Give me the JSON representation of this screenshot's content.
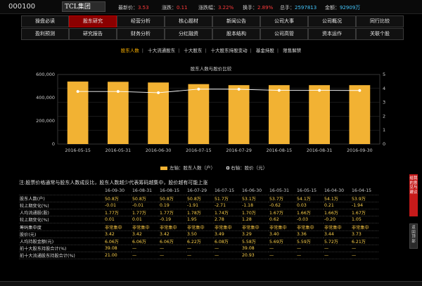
{
  "header": {
    "code": "000100",
    "name": "TCL集团",
    "latest_label": "最新价：",
    "latest_value": "3.53",
    "change_label": "涨跌：",
    "change_value": "0.11",
    "change_pct_label": "涨跌幅：",
    "change_pct_value": "3.22%",
    "turnover_label": "换手：",
    "turnover_value": "2.89%",
    "volume_label": "总手：",
    "volume_value": "2597813",
    "amount_label": "金额：",
    "amount_value": "92909万"
  },
  "nav": {
    "row1": [
      "操盘必读",
      "股东研究",
      "经营分析",
      "核心题材",
      "新闻公告",
      "公司大事",
      "公司概况",
      "同行比较"
    ],
    "row2": [
      "盈利预测",
      "研究报告",
      "财务分析",
      "分红融资",
      "股本结构",
      "公司高管",
      "资本运作",
      "关联个股"
    ]
  },
  "subtabs": [
    "股东人数",
    "十大流通股东",
    "十大股东",
    "十大股东持股变动",
    "基金持股",
    "限售解禁"
  ],
  "chart_title": "股东人数与股价比较",
  "legend": {
    "left": "左轴：股东人数（户）",
    "right": "右轴：股价（元）"
  },
  "chart_data": {
    "type": "bar",
    "categories": [
      "2016-05-15",
      "2016-05-31",
      "2016-06-30",
      "2016-07-15",
      "2016-07-29",
      "2016-08-15",
      "2016-08-31",
      "2016-09-30"
    ],
    "series": [
      {
        "name": "左轴：股东人数（户）",
        "type": "bar",
        "axis": "left",
        "values": [
          539000,
          537000,
          531000,
          517000,
          508000,
          508000,
          508000,
          508000
        ]
      },
      {
        "name": "右轴：股价（元）",
        "type": "line",
        "axis": "right",
        "values": [
          3.78,
          3.78,
          3.69,
          3.95,
          3.94,
          3.86,
          3.86,
          3.85
        ]
      }
    ],
    "left_ticks": [
      "0",
      "200,000",
      "400,000",
      "600,000"
    ],
    "right_ticks": [
      "0",
      "1",
      "2",
      "3",
      "4",
      "5"
    ],
    "ylim_left": [
      0,
      600000
    ],
    "ylim_right": [
      0,
      5
    ],
    "colors": {
      "bar": "#f2b233",
      "line": "#ffffff",
      "grid": "#555555"
    }
  },
  "note": "注:股票价格通常与股东人数成反比，股东人数越少代表筹码越集中，股价越有可能上涨",
  "table": {
    "dates": [
      "16-09-30",
      "16-08-31",
      "16-08-15",
      "16-07-29",
      "16-07-15",
      "16-06-30",
      "16-05-31",
      "16-05-15",
      "16-04-30",
      "16-04-15"
    ],
    "rows": [
      {
        "label": "股东人数(户)",
        "values": [
          "50.8万",
          "50.8万",
          "50.8万",
          "50.8万",
          "51.7万",
          "53.1万",
          "53.7万",
          "54.1万",
          "54.1万",
          "53.9万"
        ]
      },
      {
        "label": "较上期变化(%)",
        "values": [
          "-0.01",
          "-0.01",
          "0.19",
          "-1.91",
          "-2.71",
          "-1.18",
          "-0.62",
          "0.03",
          "0.21",
          "-1.94"
        ]
      },
      {
        "label": "人均流通股(股)",
        "values": [
          "1.77万",
          "1.77万",
          "1.77万",
          "1.78万",
          "1.74万",
          "1.70万",
          "1.67万",
          "1.66万",
          "1.66万",
          "1.67万"
        ]
      },
      {
        "label": "较上期变化(%)",
        "values": [
          "0.01",
          "0.01",
          "-0.19",
          "1.95",
          "2.78",
          "1.28",
          "0.62",
          "-0.03",
          "-0.20",
          "1.05"
        ]
      },
      {
        "label": "筹码集中度",
        "values": [
          "非常集中",
          "非常集中",
          "非常集中",
          "非常集中",
          "非常集中",
          "非常集中",
          "非常集中",
          "非常集中",
          "非常集中",
          "非常集中"
        ]
      },
      {
        "label": "股价(元)",
        "values": [
          "3.42",
          "3.42",
          "3.42",
          "3.50",
          "3.49",
          "3.29",
          "3.40",
          "3.36",
          "3.44",
          "3.73"
        ]
      },
      {
        "label": "人均持股金额(元)",
        "values": [
          "6.06万",
          "6.06万",
          "6.06万",
          "6.22万",
          "6.08万",
          "5.58万",
          "5.69万",
          "5.59万",
          "5.72万",
          "6.21万"
        ]
      },
      {
        "label": "前十大股东持股合计(%)",
        "values": [
          "39.08",
          "—",
          "—",
          "—",
          "—",
          "39.08",
          "—",
          "—",
          "—",
          "—"
        ]
      },
      {
        "label": "前十大流通股东持股合计(%)",
        "values": [
          "21.00",
          "—",
          "—",
          "—",
          "—",
          "20.93",
          "—",
          "—",
          "—",
          "—"
        ]
      }
    ]
  },
  "side_red": "给我的意见与建议",
  "side_dark": "返回顶部"
}
